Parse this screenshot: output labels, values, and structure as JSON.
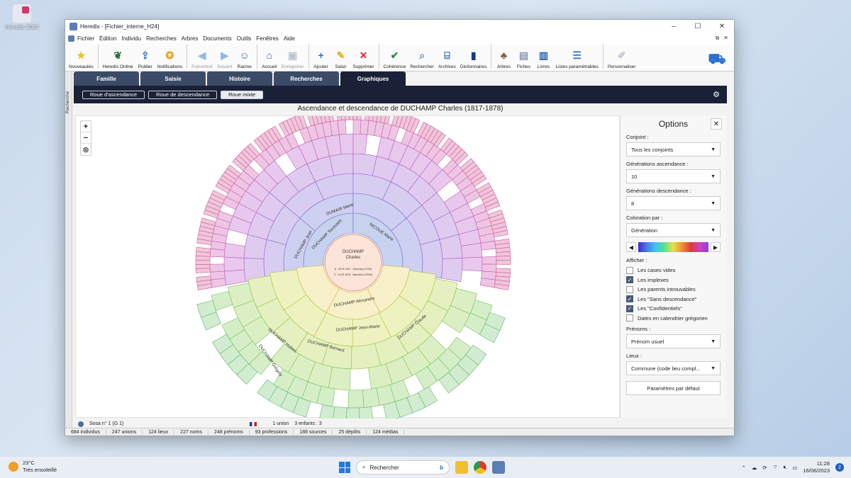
{
  "desktop": {
    "icon_label": "Heredis 2024"
  },
  "window": {
    "title": "Heredis - [Fichier_interne_H24]",
    "controls": [
      "–",
      "☐",
      "✕"
    ]
  },
  "menu": [
    "Fichier",
    "Édition",
    "Individu",
    "Recherches",
    "Arbres",
    "Documents",
    "Outils",
    "Fenêtres",
    "Aide"
  ],
  "toolbar": [
    {
      "label": "Nouveautés",
      "icon": "news-icon",
      "color": "#f0c020",
      "glyph": "★",
      "enabled": true
    },
    {
      "label": "Heredis Online",
      "icon": "leaf-icon",
      "color": "#2d6b3c",
      "glyph": "❦",
      "enabled": true
    },
    {
      "label": "Publier",
      "icon": "publish-icon",
      "color": "#3b7fc4",
      "glyph": "⇪",
      "enabled": true
    },
    {
      "label": "Notifications",
      "icon": "notification-icon",
      "color": "#e8a020",
      "glyph": "✪",
      "enabled": true
    },
    {
      "label": "Précédent",
      "icon": "arrow-left-icon",
      "color": "#8fb8e8",
      "glyph": "◀",
      "enabled": false
    },
    {
      "label": "Suivant",
      "icon": "arrow-right-icon",
      "color": "#8fb8e8",
      "glyph": "▶",
      "enabled": false
    },
    {
      "label": "Racine",
      "icon": "root-person-icon",
      "color": "#4a6fa0",
      "glyph": "☺",
      "enabled": true
    },
    {
      "label": "Accueil",
      "icon": "home-icon",
      "color": "#2a5db0",
      "glyph": "⌂",
      "enabled": true
    },
    {
      "label": "Enregistrer",
      "icon": "save-icon",
      "color": "#b8c4d4",
      "glyph": "▣",
      "enabled": false
    },
    {
      "label": "Ajouter",
      "icon": "add-icon",
      "color": "#2a6fd0",
      "glyph": "+",
      "enabled": true
    },
    {
      "label": "Saisir",
      "icon": "edit-icon",
      "color": "#e0b030",
      "glyph": "✎",
      "enabled": true
    },
    {
      "label": "Supprimer",
      "icon": "delete-icon",
      "color": "#e02a2a",
      "glyph": "✕",
      "enabled": true
    },
    {
      "label": "Cohérence",
      "icon": "coherence-icon",
      "color": "#2a8a4a",
      "glyph": "✔",
      "enabled": true
    },
    {
      "label": "Rechercher",
      "icon": "search-icon",
      "color": "#6a8ab0",
      "glyph": "⌕",
      "enabled": true
    },
    {
      "label": "Archives",
      "icon": "archives-icon",
      "color": "#2a6ab0",
      "glyph": "⌸",
      "enabled": true
    },
    {
      "label": "Dictionnaires",
      "icon": "dictionary-icon",
      "color": "#1a3a80",
      "glyph": "▮",
      "enabled": true
    },
    {
      "label": "Arbres",
      "icon": "tree-icon",
      "color": "#7a5a3a",
      "glyph": "♣",
      "enabled": true
    },
    {
      "label": "Fiches",
      "icon": "cards-icon",
      "color": "#8a9ab0",
      "glyph": "▤",
      "enabled": true
    },
    {
      "label": "Livres",
      "icon": "book-icon",
      "color": "#2a6ab0",
      "glyph": "▥",
      "enabled": true
    },
    {
      "label": "Listes paramétrables",
      "icon": "list-settings-icon",
      "color": "#3a7ad0",
      "glyph": "☰",
      "enabled": true
    },
    {
      "label": "Personnaliser",
      "icon": "customize-icon",
      "color": "#c0c8d8",
      "glyph": "✐",
      "enabled": true
    }
  ],
  "basket_icon": "basket-icon",
  "sidebar_label": "Recherche",
  "tabs": [
    "Famille",
    "Saisie",
    "Histoire",
    "Recherches",
    "Graphiques"
  ],
  "active_tab": "Graphiques",
  "subtabs": [
    "Roue d'ascendance",
    "Roue de descendance",
    "Roue mixte"
  ],
  "active_subtab": "Roue mixte",
  "chart": {
    "title": "Ascendance et descendance de DUCHAMP Charles (1817-1878)",
    "root": {
      "surname": "DUCHAMP",
      "given": "Charles",
      "birth": "N : 09.01.1817 - Annonay (07130)",
      "death": "D : 14.03.1878 - Samoëns (74340)"
    },
    "ancestor_labels": [
      "DUCHAMP Jean",
      "DUCHAMP Toussaint",
      "DUMAIR Marie",
      "NICOUE Marie"
    ],
    "descendant_labels": [
      "DUCHAMP Alexandre",
      "DUCHAMP Jean-Marie",
      "DUCHAMP Claude",
      "DUCHAMP Hubert",
      "DUCHAMP Bernard",
      "DUCHAMP Grégory"
    ],
    "zoom": [
      "+",
      "−",
      "◎"
    ]
  },
  "options": {
    "title": "Options",
    "conjoint": {
      "label": "Conjoint :",
      "value": "Tous les conjoints"
    },
    "gen_asc": {
      "label": "Générations ascendance :",
      "value": "10"
    },
    "gen_desc": {
      "label": "Générations descendance :",
      "value": "8"
    },
    "coloration": {
      "label": "Coloration par :",
      "value": "Génération"
    },
    "afficher_label": "Afficher :",
    "checkboxes": [
      {
        "label": "Les cases vides",
        "checked": false
      },
      {
        "label": "Les implexes",
        "checked": true
      },
      {
        "label": "Les parents introuvables",
        "checked": false
      },
      {
        "label": "Les \"Sans descendance\"",
        "checked": true
      },
      {
        "label": "Les \"Confidentiels\"",
        "checked": true
      },
      {
        "label": "Dates en calendrier grégorien",
        "checked": false
      }
    ],
    "prenoms": {
      "label": "Prénoms :",
      "value": "Prénom usuel"
    },
    "lieux": {
      "label": "Lieux :",
      "value": "Commune (code lieu compl..."
    },
    "reset": "Paramètres par défaut"
  },
  "status1": {
    "sosa": "Sosa n° 1 (G 1)",
    "union": "1 union",
    "children": "3 enfants : 3"
  },
  "status2": [
    "684 individus",
    "247 unions",
    "124 lieux",
    "227 noms",
    "248 prénoms",
    "93 professions",
    "188 sources",
    "25 dépôts",
    "124 médias"
  ],
  "taskbar": {
    "temp": "23°C",
    "weather": "Très ensoleillé",
    "search_placeholder": "Rechercher",
    "time": "11:28",
    "date": "16/06/2023",
    "notif_count": "2"
  }
}
